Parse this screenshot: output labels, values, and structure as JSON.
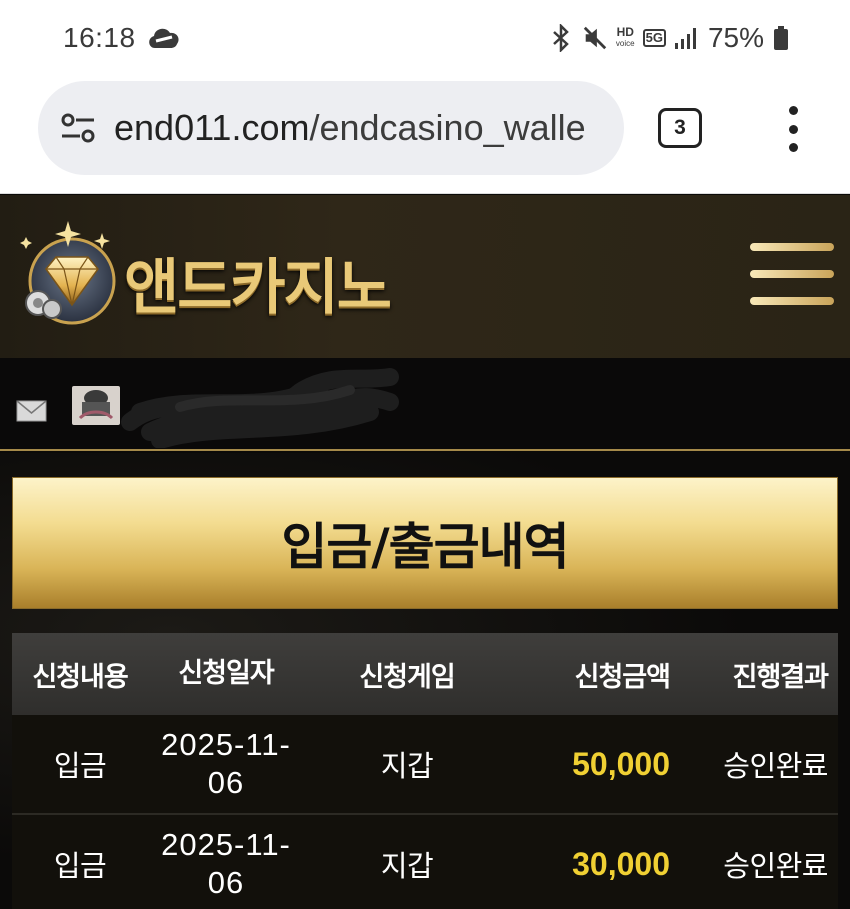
{
  "status_bar": {
    "time": "16:18",
    "battery": "75%",
    "hd_label": "HD",
    "voice_label": "voice",
    "net_label": "5G"
  },
  "browser": {
    "url_host": "end011.com",
    "url_path": "/endcasino_walle",
    "tab_count": "3"
  },
  "site": {
    "logo_text": "앤드카지노",
    "page_title": "입금/출금내역"
  },
  "table": {
    "headers": [
      "신청내용",
      "신청일자",
      "신청게임",
      "신청금액",
      "진행결과"
    ],
    "rows": [
      {
        "type": "입금",
        "date": "2025-11-06",
        "game": "지갑",
        "amount": "50,000",
        "result": "승인완료"
      },
      {
        "type": "입금",
        "date": "2025-11-06",
        "game": "지갑",
        "amount": "30,000",
        "result": "승인완료"
      }
    ]
  },
  "colors": {
    "amount": "#f0d033",
    "header_bg": "#2f2718",
    "gold": "#e9c978"
  }
}
